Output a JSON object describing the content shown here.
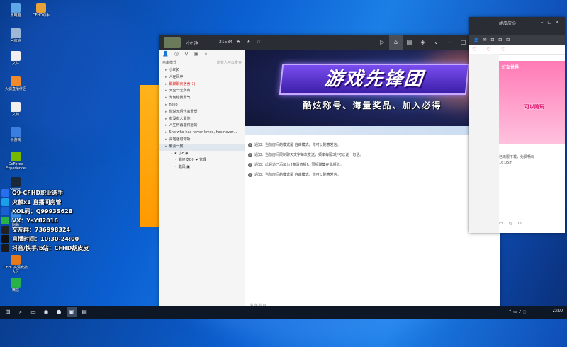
{
  "desktop_icons": [
    {
      "label": "此电脑",
      "color": "#5fa8e8"
    },
    {
      "label": "CFHD助手",
      "color": "#e8a23a"
    },
    {
      "label": "回收站",
      "color": "#9fb7d6"
    },
    {
      "label": "文件",
      "color": "#f0f0f0"
    },
    {
      "label": "火狐直播伴侣",
      "color": "#f08a2a"
    },
    {
      "label": "文档",
      "color": "#f0f0f0"
    },
    {
      "label": "云游戏",
      "color": "#3a7fe0"
    },
    {
      "label": "GeForce Experience",
      "color": "#76b900"
    },
    {
      "label": "Steam",
      "color": "#1b2838"
    },
    {
      "label": "网易",
      "color": "#3a8ee6"
    },
    {
      "label": "CFHD高清竞技大区",
      "color": "#e87a1a"
    },
    {
      "label": "微信",
      "color": "#2ab24a"
    }
  ],
  "stream_overlay": [
    {
      "text": "Q9·CFHD职业选手",
      "color": "#2a6ef0"
    },
    {
      "text": "火麒x1 直播间房管",
      "color": "#1aa0e8"
    },
    {
      "text": "KOL码：Q9993S628",
      "color": "#1a5fd0"
    },
    {
      "text": "VX：YsYfl2016",
      "color": "#2ab24a"
    },
    {
      "text": "交友群：736998324",
      "color": "#222222"
    },
    {
      "text": "直播时间：10:30-24:00",
      "color": "#111111"
    },
    {
      "text": "抖音/快手/b站：CFHD胡皮皮",
      "color": "#1a1a1a"
    }
  ],
  "app": {
    "user_name": "小H净",
    "user_id": "21584",
    "member_count": "4",
    "title_icons": "★ ✈ ☆",
    "mode_label": "自由模式",
    "mode_hint": "所有人可以发言",
    "toolbar_icons": "👤 ◎ ⚲ ▣ ⌕",
    "channels": [
      {
        "name": "小H家",
        "style": "normal"
      },
      {
        "name": "人在风中",
        "style": "normal"
      },
      {
        "name": "聚聚聊天宿舍(1)",
        "style": "red"
      },
      {
        "name": "天空一无所有",
        "style": "normal"
      },
      {
        "name": "为何给我勇气",
        "style": "normal"
      },
      {
        "name": "hello",
        "style": "normal"
      },
      {
        "name": "你说无后也会重塑",
        "style": "normal"
      },
      {
        "name": "有没有人爱你",
        "style": "normal"
      },
      {
        "name": "人生何再能得圆的",
        "style": "normal"
      },
      {
        "name": "She who has never loved, has never…",
        "style": "normal"
      },
      {
        "name": "青地迷可你听",
        "style": "normal"
      },
      {
        "name": "聚会一房",
        "style": "selected"
      },
      {
        "name": "★ 小H净",
        "style": "sub"
      },
      {
        "name": "胡皮皮Q9 ❤ 管理",
        "style": "sub2"
      },
      {
        "name": "酷风 ▣",
        "style": "sub2"
      }
    ],
    "banner_title": "游戏先锋团",
    "banner_subtitle": "酷炫称号、海量奖品、加入必得",
    "messages": [
      "通知：当前房间的模式是 自由模式，你可以随意发言。",
      "通知：当前房间限制聊天文字每次发送，频率每隔3秒可以说一句话。",
      "通知：此频道已添加为 [高清直播]，同频聚集在此频道。",
      "通知：当前房间的模式是 自由模式，你可以随意发言。"
    ],
    "input_placeholder": "发送消息..."
  },
  "right_window": {
    "title": "胡皮皮@",
    "tabs": "♡ ♡ ♡",
    "banner_tag": "好友世界",
    "banner_tag2": "可以陪玩",
    "text_lines": [
      "已无限下载，免费畅玩",
      "16:05m"
    ]
  },
  "taskbar": {
    "time": "23:00"
  }
}
